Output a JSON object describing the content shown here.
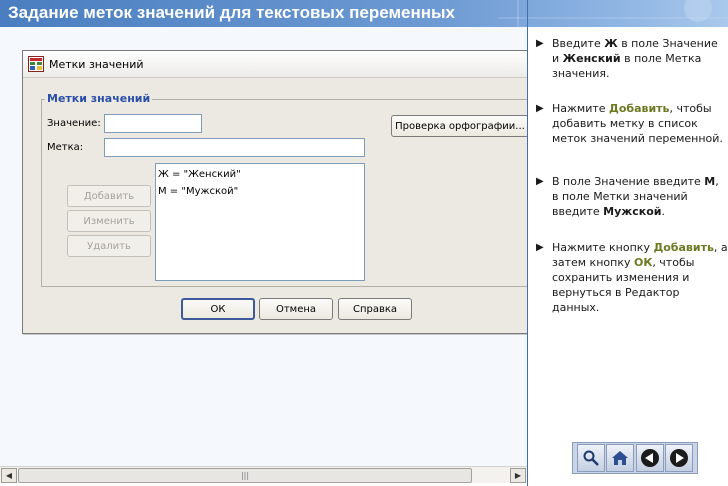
{
  "page": {
    "title": "Задание меток значений для текстовых переменных"
  },
  "dialog": {
    "title": "Метки значений",
    "group_label": "Метки значений",
    "value_label": "Значение:",
    "value_input": "",
    "label_label": "Метка:",
    "label_input": "",
    "spell_button": "Проверка орфографии...",
    "add_button": "Добавить",
    "change_button": "Изменить",
    "delete_button": "Удалить",
    "list_items": [
      "Ж = \"Женский\"",
      "М = \"Мужской\""
    ],
    "ok_button": "ОК",
    "cancel_button": "Отмена",
    "help_button": "Справка"
  },
  "scrollbar": {
    "left_arrow": "◀",
    "right_arrow": "▶",
    "grip": "|||"
  },
  "instructions": {
    "arrow": "▶",
    "step1": {
      "t1": "Введите ",
      "b1": "Ж",
      "t2": " в поле Значение и ",
      "b2": "Женский",
      "t3": " в поле Метка значения."
    },
    "step2": {
      "t1": "Нажмите ",
      "h1": "Добавить",
      "t2": ", чтобы добавить метку в список меток значений переменной."
    },
    "step3": {
      "t1": "В поле Значение введите ",
      "b1": "М",
      "t2": ", в поле Метки значений введите ",
      "b2": "Мужской",
      "t3": "."
    },
    "step4": {
      "t1": "Нажмите кнопку ",
      "h1": "Добавить",
      "t2": ", а затем кнопку ",
      "h2": "ОК",
      "t3": ", чтобы сохранить изменения и вернуться в Редактор данных."
    }
  },
  "nav": {
    "icons": [
      "search-icon",
      "home-icon",
      "back-icon",
      "forward-icon"
    ]
  },
  "colors": {
    "title_bar": "#4a7ec0",
    "highlight": "#6e7a22",
    "legend": "#2a4fa8"
  }
}
